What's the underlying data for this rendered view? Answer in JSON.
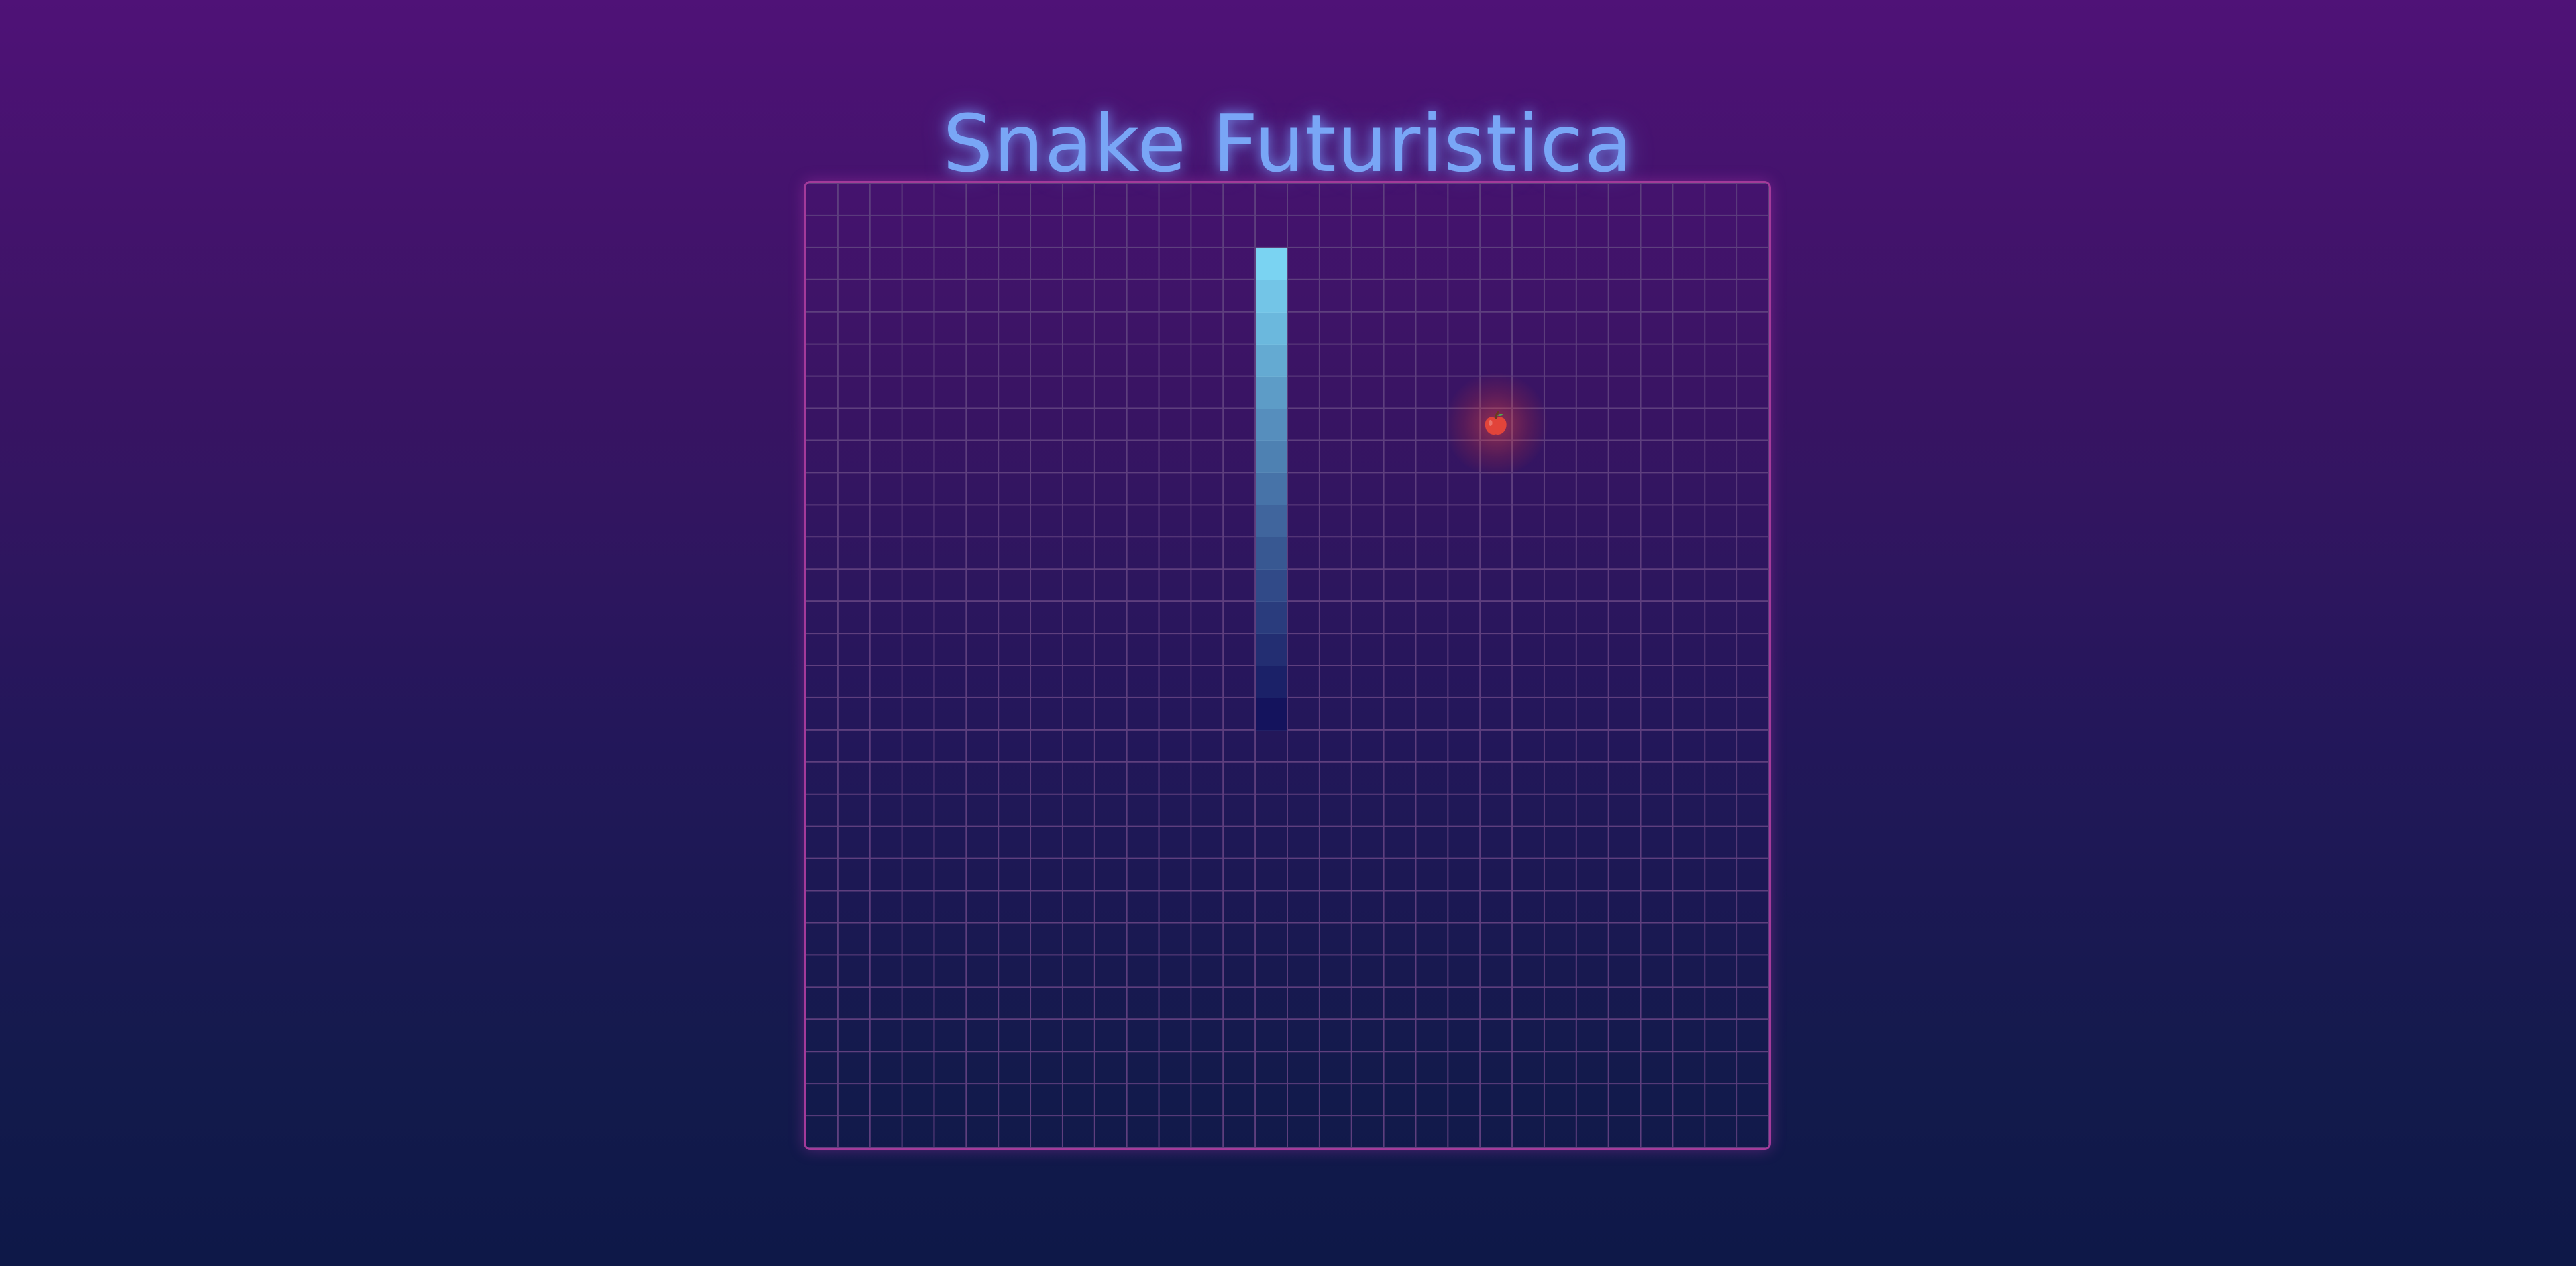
{
  "title": "Snake Futuristica",
  "board": {
    "cols": 30,
    "rows": 30,
    "grid_line_color": "#5e3f7e",
    "border_color": "#a33a9a"
  },
  "snake": {
    "head_color": "#7ad3f2",
    "tail_color": "#14135d",
    "segments": [
      {
        "col": 14,
        "row": 2
      },
      {
        "col": 14,
        "row": 3
      },
      {
        "col": 14,
        "row": 4
      },
      {
        "col": 14,
        "row": 5
      },
      {
        "col": 14,
        "row": 6
      },
      {
        "col": 14,
        "row": 7
      },
      {
        "col": 14,
        "row": 8
      },
      {
        "col": 14,
        "row": 9
      },
      {
        "col": 14,
        "row": 10
      },
      {
        "col": 14,
        "row": 11
      },
      {
        "col": 14,
        "row": 12
      },
      {
        "col": 14,
        "row": 13
      },
      {
        "col": 14,
        "row": 14
      },
      {
        "col": 14,
        "row": 15
      },
      {
        "col": 14,
        "row": 16
      }
    ]
  },
  "food": {
    "col": 21,
    "row": 7,
    "icon": "apple-icon",
    "color": "#e2443a"
  }
}
